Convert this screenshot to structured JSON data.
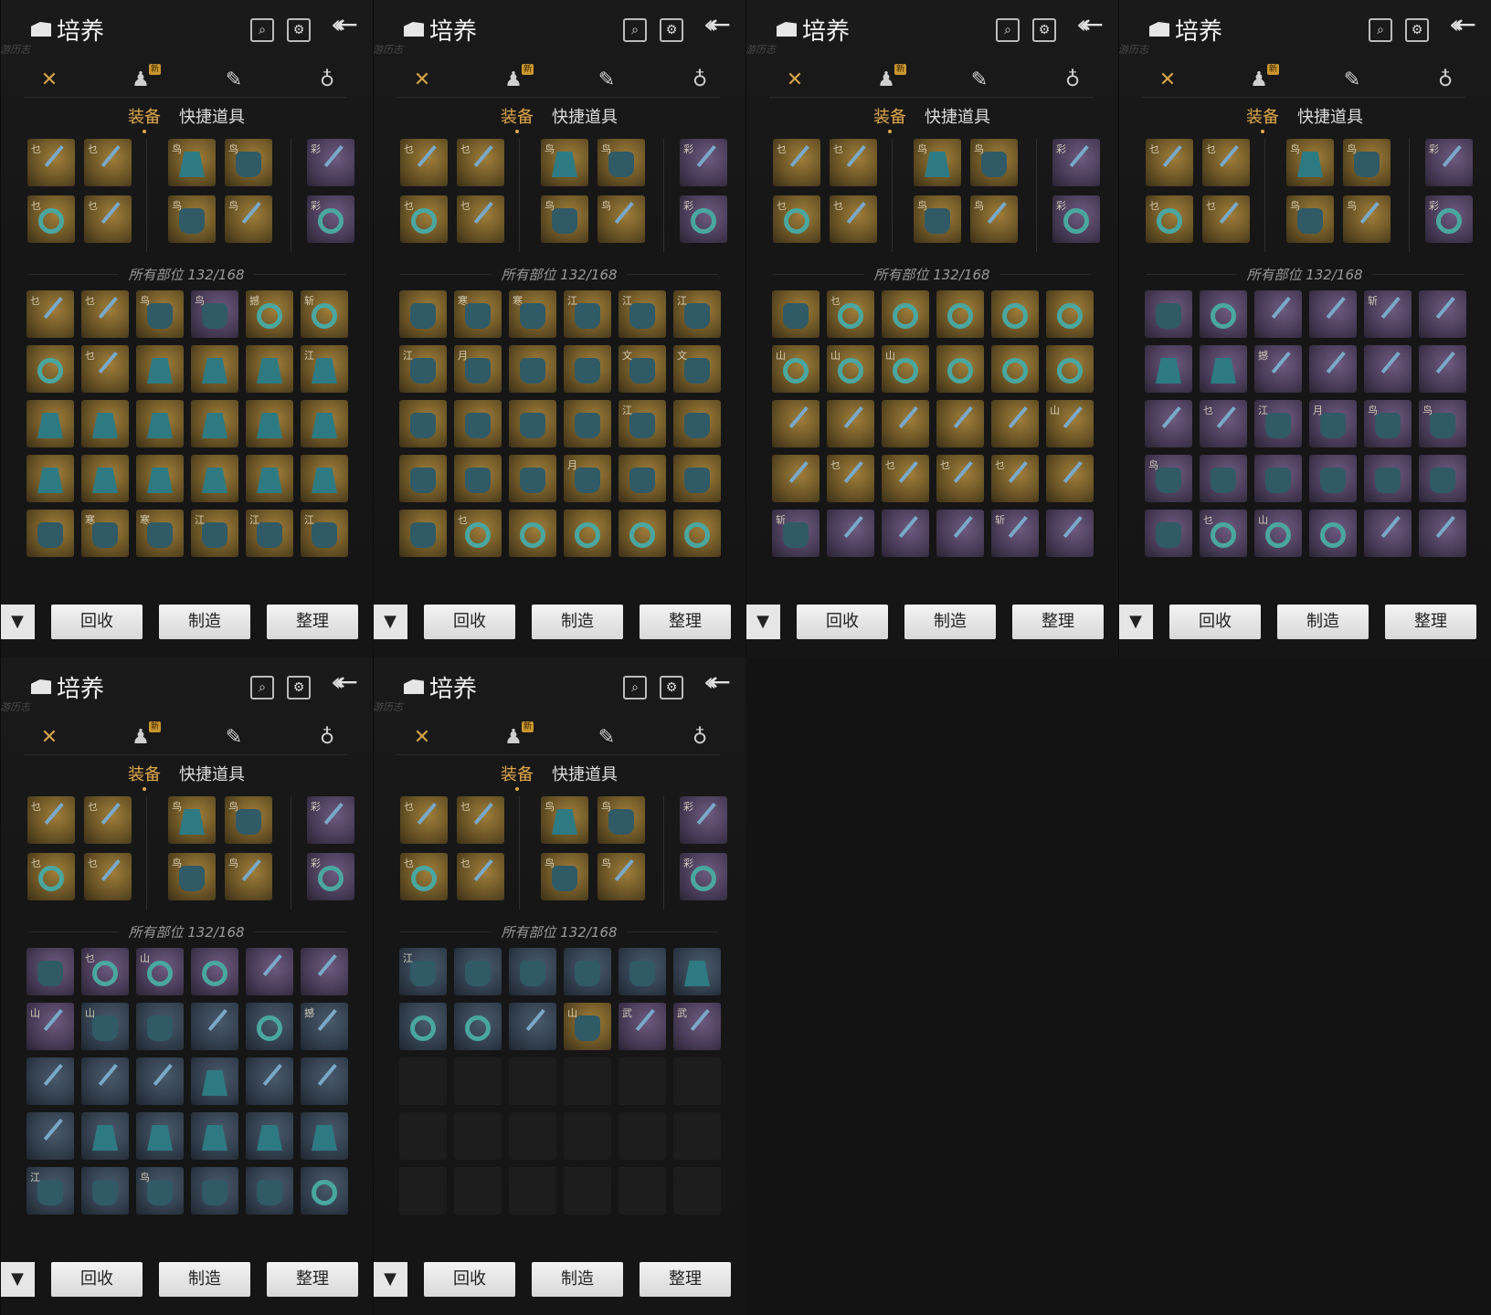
{
  "title": "培养",
  "subtitle": "游历志",
  "new_badge": "新",
  "tabs": {
    "equipment": "装备",
    "quick_items": "快捷道具"
  },
  "slot_count": "所有部位 132/168",
  "buttons": {
    "recycle": "回收",
    "craft": "制造",
    "sort": "整理"
  },
  "colors": {
    "accent": "#e0a84a",
    "gold_rarity": "#8a6b2e",
    "purple_rarity": "#5a4a6c",
    "blue_rarity": "#3a4858"
  },
  "equipped": [
    {
      "r": "gold",
      "m": "乜",
      "g": "blade"
    },
    {
      "r": "gold",
      "m": "乜",
      "g": "blade"
    },
    {
      "r": "gold",
      "m": "鸟",
      "g": "cloak"
    },
    {
      "r": "gold",
      "m": "鸟",
      "g": "glove"
    },
    {
      "r": "purple",
      "m": "彩",
      "g": "blade"
    },
    {
      "r": "gold",
      "m": "乜",
      "g": "ring"
    },
    {
      "r": "gold",
      "m": "乜",
      "g": "blade"
    },
    {
      "r": "gold",
      "m": "鸟",
      "g": "glove"
    },
    {
      "r": "gold",
      "m": "鸟",
      "g": "blade"
    },
    {
      "r": "purple",
      "m": "彩",
      "g": "ring"
    }
  ],
  "panels": [
    {
      "grid": [
        {
          "r": "gold",
          "m": "乜",
          "g": "blade"
        },
        {
          "r": "gold",
          "m": "乜",
          "g": "blade"
        },
        {
          "r": "gold",
          "m": "鸟",
          "g": "glove"
        },
        {
          "r": "purple",
          "m": "鸟",
          "g": "glove"
        },
        {
          "r": "gold",
          "m": "撼",
          "g": "ring"
        },
        {
          "r": "gold",
          "m": "斩",
          "g": "ring"
        },
        {
          "r": "gold",
          "m": "",
          "g": "ring"
        },
        {
          "r": "gold",
          "m": "乜",
          "g": "blade"
        },
        {
          "r": "gold",
          "m": "",
          "g": "cloak"
        },
        {
          "r": "gold",
          "m": "",
          "g": "cloak"
        },
        {
          "r": "gold",
          "m": "",
          "g": "cloak"
        },
        {
          "r": "gold",
          "m": "江",
          "g": "cloak"
        },
        {
          "r": "gold",
          "m": "",
          "g": "cloak"
        },
        {
          "r": "gold",
          "m": "",
          "g": "cloak"
        },
        {
          "r": "gold",
          "m": "",
          "g": "cloak"
        },
        {
          "r": "gold",
          "m": "",
          "g": "cloak"
        },
        {
          "r": "gold",
          "m": "",
          "g": "cloak"
        },
        {
          "r": "gold",
          "m": "",
          "g": "cloak"
        },
        {
          "r": "gold",
          "m": "",
          "g": "cloak"
        },
        {
          "r": "gold",
          "m": "",
          "g": "cloak"
        },
        {
          "r": "gold",
          "m": "",
          "g": "cloak"
        },
        {
          "r": "gold",
          "m": "",
          "g": "cloak"
        },
        {
          "r": "gold",
          "m": "",
          "g": "cloak"
        },
        {
          "r": "gold",
          "m": "",
          "g": "cloak"
        },
        {
          "r": "gold",
          "m": "",
          "g": "glove"
        },
        {
          "r": "gold",
          "m": "寒",
          "g": "glove"
        },
        {
          "r": "gold",
          "m": "寒",
          "g": "glove"
        },
        {
          "r": "gold",
          "m": "江",
          "g": "glove"
        },
        {
          "r": "gold",
          "m": "江",
          "g": "glove"
        },
        {
          "r": "gold",
          "m": "江",
          "g": "glove"
        }
      ]
    },
    {
      "grid": [
        {
          "r": "gold",
          "m": "",
          "g": "glove"
        },
        {
          "r": "gold",
          "m": "寒",
          "g": "glove"
        },
        {
          "r": "gold",
          "m": "寒",
          "g": "glove"
        },
        {
          "r": "gold",
          "m": "江",
          "g": "glove"
        },
        {
          "r": "gold",
          "m": "江",
          "g": "glove"
        },
        {
          "r": "gold",
          "m": "江",
          "g": "glove"
        },
        {
          "r": "gold",
          "m": "江",
          "g": "glove"
        },
        {
          "r": "gold",
          "m": "月",
          "g": "glove"
        },
        {
          "r": "gold",
          "m": "",
          "g": "glove"
        },
        {
          "r": "gold",
          "m": "",
          "g": "glove"
        },
        {
          "r": "gold",
          "m": "文",
          "g": "glove"
        },
        {
          "r": "gold",
          "m": "文",
          "g": "glove"
        },
        {
          "r": "gold",
          "m": "",
          "g": "glove"
        },
        {
          "r": "gold",
          "m": "",
          "g": "glove"
        },
        {
          "r": "gold",
          "m": "",
          "g": "glove"
        },
        {
          "r": "gold",
          "m": "",
          "g": "glove"
        },
        {
          "r": "gold",
          "m": "江",
          "g": "glove"
        },
        {
          "r": "gold",
          "m": "",
          "g": "glove"
        },
        {
          "r": "gold",
          "m": "",
          "g": "glove"
        },
        {
          "r": "gold",
          "m": "",
          "g": "glove"
        },
        {
          "r": "gold",
          "m": "",
          "g": "glove"
        },
        {
          "r": "gold",
          "m": "月",
          "g": "glove"
        },
        {
          "r": "gold",
          "m": "",
          "g": "glove"
        },
        {
          "r": "gold",
          "m": "",
          "g": "glove"
        },
        {
          "r": "gold",
          "m": "",
          "g": "glove"
        },
        {
          "r": "gold",
          "m": "乜",
          "g": "ring"
        },
        {
          "r": "gold",
          "m": "",
          "g": "ring"
        },
        {
          "r": "gold",
          "m": "",
          "g": "ring"
        },
        {
          "r": "gold",
          "m": "",
          "g": "ring"
        },
        {
          "r": "gold",
          "m": "",
          "g": "ring"
        }
      ]
    },
    {
      "grid": [
        {
          "r": "gold",
          "m": "",
          "g": "glove"
        },
        {
          "r": "gold",
          "m": "乜",
          "g": "ring"
        },
        {
          "r": "gold",
          "m": "",
          "g": "ring"
        },
        {
          "r": "gold",
          "m": "",
          "g": "ring"
        },
        {
          "r": "gold",
          "m": "",
          "g": "ring"
        },
        {
          "r": "gold",
          "m": "",
          "g": "ring"
        },
        {
          "r": "gold",
          "m": "山",
          "g": "ring"
        },
        {
          "r": "gold",
          "m": "山",
          "g": "ring"
        },
        {
          "r": "gold",
          "m": "山",
          "g": "ring"
        },
        {
          "r": "gold",
          "m": "",
          "g": "ring"
        },
        {
          "r": "gold",
          "m": "",
          "g": "ring"
        },
        {
          "r": "gold",
          "m": "",
          "g": "ring"
        },
        {
          "r": "gold",
          "m": "",
          "g": "blade"
        },
        {
          "r": "gold",
          "m": "",
          "g": "blade"
        },
        {
          "r": "gold",
          "m": "",
          "g": "blade"
        },
        {
          "r": "gold",
          "m": "",
          "g": "blade"
        },
        {
          "r": "gold",
          "m": "",
          "g": "blade"
        },
        {
          "r": "gold",
          "m": "山",
          "g": "blade"
        },
        {
          "r": "gold",
          "m": "",
          "g": "blade"
        },
        {
          "r": "gold",
          "m": "乜",
          "g": "blade"
        },
        {
          "r": "gold",
          "m": "乜",
          "g": "blade"
        },
        {
          "r": "gold",
          "m": "乜",
          "g": "blade"
        },
        {
          "r": "gold",
          "m": "乜",
          "g": "blade"
        },
        {
          "r": "gold",
          "m": "",
          "g": "blade"
        },
        {
          "r": "purple",
          "m": "斩",
          "g": "glove"
        },
        {
          "r": "purple",
          "m": "",
          "g": "blade"
        },
        {
          "r": "purple",
          "m": "",
          "g": "blade"
        },
        {
          "r": "purple",
          "m": "",
          "g": "blade"
        },
        {
          "r": "purple",
          "m": "斩",
          "g": "blade"
        },
        {
          "r": "purple",
          "m": "",
          "g": "blade"
        }
      ]
    },
    {
      "grid": [
        {
          "r": "purple",
          "m": "",
          "g": "glove"
        },
        {
          "r": "purple",
          "m": "",
          "g": "ring"
        },
        {
          "r": "purple",
          "m": "",
          "g": "blade"
        },
        {
          "r": "purple",
          "m": "",
          "g": "blade"
        },
        {
          "r": "purple",
          "m": "斩",
          "g": "blade"
        },
        {
          "r": "purple",
          "m": "",
          "g": "blade"
        },
        {
          "r": "purple",
          "m": "",
          "g": "cloak"
        },
        {
          "r": "purple",
          "m": "",
          "g": "cloak"
        },
        {
          "r": "purple",
          "m": "撼",
          "g": "blade"
        },
        {
          "r": "purple",
          "m": "",
          "g": "blade"
        },
        {
          "r": "purple",
          "m": "",
          "g": "blade"
        },
        {
          "r": "purple",
          "m": "",
          "g": "blade"
        },
        {
          "r": "purple",
          "m": "",
          "g": "blade"
        },
        {
          "r": "purple",
          "m": "乜",
          "g": "blade"
        },
        {
          "r": "purple",
          "m": "江",
          "g": "glove"
        },
        {
          "r": "purple",
          "m": "月",
          "g": "glove"
        },
        {
          "r": "purple",
          "m": "鸟",
          "g": "glove"
        },
        {
          "r": "purple",
          "m": "鸟",
          "g": "glove"
        },
        {
          "r": "purple",
          "m": "鸟",
          "g": "glove"
        },
        {
          "r": "purple",
          "m": "",
          "g": "glove"
        },
        {
          "r": "purple",
          "m": "",
          "g": "glove"
        },
        {
          "r": "purple",
          "m": "",
          "g": "glove"
        },
        {
          "r": "purple",
          "m": "",
          "g": "glove"
        },
        {
          "r": "purple",
          "m": "",
          "g": "glove"
        },
        {
          "r": "purple",
          "m": "",
          "g": "glove"
        },
        {
          "r": "purple",
          "m": "乜",
          "g": "ring"
        },
        {
          "r": "purple",
          "m": "山",
          "g": "ring"
        },
        {
          "r": "purple",
          "m": "",
          "g": "ring"
        },
        {
          "r": "purple",
          "m": "",
          "g": "blade"
        },
        {
          "r": "purple",
          "m": "",
          "g": "blade"
        }
      ]
    },
    {
      "grid": [
        {
          "r": "purple",
          "m": "",
          "g": "glove"
        },
        {
          "r": "purple",
          "m": "乜",
          "g": "ring"
        },
        {
          "r": "purple",
          "m": "山",
          "g": "ring"
        },
        {
          "r": "purple",
          "m": "",
          "g": "ring"
        },
        {
          "r": "purple",
          "m": "",
          "g": "blade"
        },
        {
          "r": "purple",
          "m": "",
          "g": "blade"
        },
        {
          "r": "purple",
          "m": "山",
          "g": "blade"
        },
        {
          "r": "blue",
          "m": "山",
          "g": "glove"
        },
        {
          "r": "blue",
          "m": "",
          "g": "glove"
        },
        {
          "r": "blue",
          "m": "",
          "g": "blade"
        },
        {
          "r": "blue",
          "m": "",
          "g": "ring"
        },
        {
          "r": "blue",
          "m": "撼",
          "g": "blade"
        },
        {
          "r": "blue",
          "m": "",
          "g": "blade"
        },
        {
          "r": "blue",
          "m": "",
          "g": "blade"
        },
        {
          "r": "blue",
          "m": "",
          "g": "blade"
        },
        {
          "r": "blue",
          "m": "",
          "g": "cloak"
        },
        {
          "r": "blue",
          "m": "",
          "g": "blade"
        },
        {
          "r": "blue",
          "m": "",
          "g": "blade"
        },
        {
          "r": "blue",
          "m": "",
          "g": "blade"
        },
        {
          "r": "blue",
          "m": "",
          "g": "cloak"
        },
        {
          "r": "blue",
          "m": "",
          "g": "cloak"
        },
        {
          "r": "blue",
          "m": "",
          "g": "cloak"
        },
        {
          "r": "blue",
          "m": "",
          "g": "cloak"
        },
        {
          "r": "blue",
          "m": "",
          "g": "cloak"
        },
        {
          "r": "blue",
          "m": "江",
          "g": "glove"
        },
        {
          "r": "blue",
          "m": "",
          "g": "glove"
        },
        {
          "r": "blue",
          "m": "鸟",
          "g": "glove"
        },
        {
          "r": "blue",
          "m": "",
          "g": "glove"
        },
        {
          "r": "blue",
          "m": "",
          "g": "glove"
        },
        {
          "r": "blue",
          "m": "",
          "g": "ring"
        }
      ]
    },
    {
      "grid": [
        {
          "r": "blue",
          "m": "江",
          "g": "glove"
        },
        {
          "r": "blue",
          "m": "",
          "g": "glove"
        },
        {
          "r": "blue",
          "m": "",
          "g": "glove"
        },
        {
          "r": "blue",
          "m": "",
          "g": "glove"
        },
        {
          "r": "blue",
          "m": "",
          "g": "glove"
        },
        {
          "r": "blue",
          "m": "",
          "g": "cloak"
        },
        {
          "r": "blue",
          "m": "",
          "g": "ring"
        },
        {
          "r": "blue",
          "m": "",
          "g": "ring"
        },
        {
          "r": "blue",
          "m": "",
          "g": "blade"
        },
        {
          "r": "gold",
          "m": "山",
          "g": "glove"
        },
        {
          "r": "purple",
          "m": "武",
          "g": "blade"
        },
        {
          "r": "purple",
          "m": "武",
          "g": "blade"
        },
        {
          "r": "empty"
        },
        {
          "r": "empty"
        },
        {
          "r": "empty"
        },
        {
          "r": "empty"
        },
        {
          "r": "empty"
        },
        {
          "r": "empty"
        },
        {
          "r": "empty"
        },
        {
          "r": "empty"
        },
        {
          "r": "empty"
        },
        {
          "r": "empty"
        },
        {
          "r": "empty"
        },
        {
          "r": "empty"
        },
        {
          "r": "empty"
        },
        {
          "r": "empty"
        },
        {
          "r": "empty"
        },
        {
          "r": "empty"
        },
        {
          "r": "empty"
        },
        {
          "r": "empty"
        }
      ]
    }
  ]
}
